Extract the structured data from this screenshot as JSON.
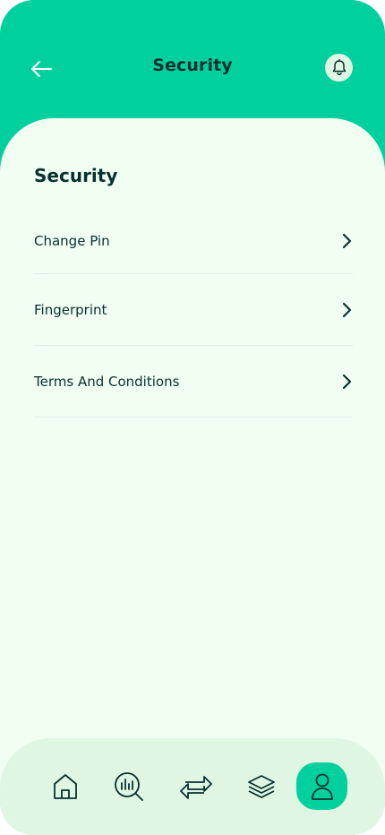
{
  "header": {
    "title": "Security",
    "back_icon": "arrow-left-icon",
    "notification_icon": "bell-icon"
  },
  "section": {
    "title": "Security"
  },
  "menu": [
    {
      "label": "Change Pin",
      "icon": "chevron-right-icon"
    },
    {
      "label": "Fingerprint",
      "icon": "chevron-right-icon"
    },
    {
      "label": "Terms And Conditions",
      "icon": "chevron-right-icon"
    }
  ],
  "bottom_nav": {
    "items": [
      {
        "icon": "home-icon"
      },
      {
        "icon": "analysis-icon"
      },
      {
        "icon": "transactions-icon"
      },
      {
        "icon": "categories-icon"
      },
      {
        "icon": "profile-icon",
        "active": true
      }
    ]
  },
  "colors": {
    "primary": "#00D09E",
    "background": "#F1FFF3",
    "surface": "#DFF7E2",
    "text_dark": "#093030"
  }
}
